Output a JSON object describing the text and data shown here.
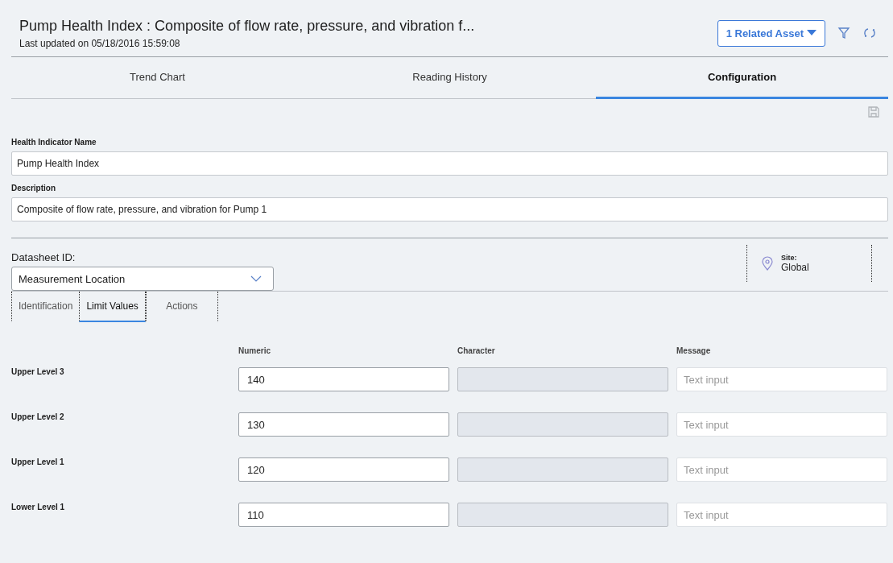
{
  "header": {
    "title": "Pump Health Index : Composite of flow rate, pressure, and vibration f...",
    "updated": "Last updated on 05/18/2016 15:59:08",
    "related_button": "1 Related Asset"
  },
  "tabs": [
    {
      "label": "Trend Chart",
      "selected": false
    },
    {
      "label": "Reading History",
      "selected": false
    },
    {
      "label": "Configuration",
      "selected": true
    }
  ],
  "form": {
    "fields": [
      {
        "label": "Health Indicator Name",
        "value": "Pump Health Index"
      },
      {
        "label": "Description",
        "value": "Composite of flow rate, pressure, and vibration for Pump 1"
      }
    ]
  },
  "datasheet": {
    "label": "Datasheet ID:",
    "value": "Measurement Location",
    "site_label": "Site:",
    "site_value": "Global"
  },
  "subtabs": [
    {
      "label": "Identification",
      "selected": false
    },
    {
      "label": "Limit Values",
      "selected": true
    },
    {
      "label": "Actions",
      "selected": false
    }
  ],
  "limits": {
    "columns": [
      "Numeric",
      "Character",
      "Message"
    ],
    "rows": [
      {
        "label": "Upper Level 3",
        "numeric": "140",
        "message_placeholder": "Text input"
      },
      {
        "label": "Upper Level 2",
        "numeric": "130",
        "message_placeholder": "Text input"
      },
      {
        "label": "Upper Level 1",
        "numeric": "120",
        "message_placeholder": "Text input"
      },
      {
        "label": "Lower Level 1",
        "numeric": "110",
        "message_placeholder": "Text input"
      }
    ]
  }
}
